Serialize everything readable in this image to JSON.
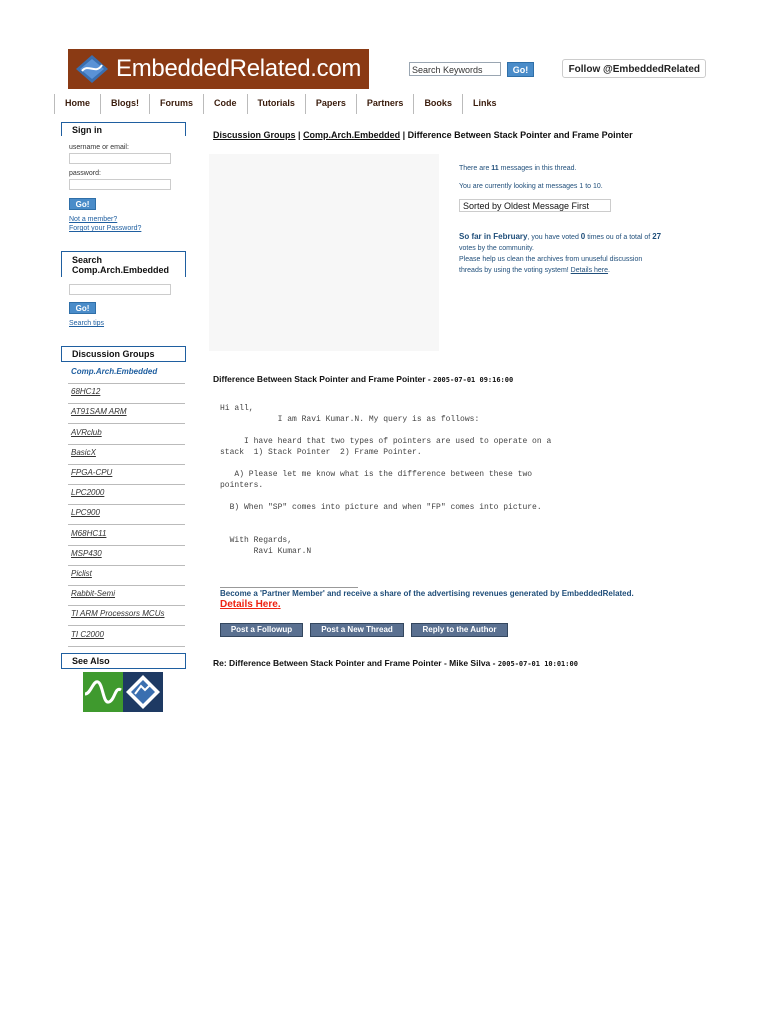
{
  "header": {
    "logo_text": "EmbeddedRelated.com",
    "search_placeholder": "Search Keywords",
    "search_button": "Go!",
    "follow_label": "Follow @EmbeddedRelated"
  },
  "nav": [
    "Home",
    "Blogs!",
    "Forums",
    "Code",
    "Tutorials",
    "Papers",
    "Partners",
    "Books",
    "Links"
  ],
  "signin": {
    "title": "Sign in",
    "username_label": "username or email:",
    "password_label": "password:",
    "go_button": "Go!",
    "not_member": "Not a member?",
    "forgot": "Forgot your Password?"
  },
  "search_group": {
    "title_line1": "Search",
    "title_line2": "Comp.Arch.Embedded",
    "go_button": "Go!",
    "tips": "Search tips"
  },
  "discussion_groups": {
    "title": "Discussion Groups",
    "items": [
      "Comp.Arch.Embedded",
      "68HC12",
      "AT91SAM ARM",
      "AVRclub",
      "BasicX",
      "FPGA-CPU",
      "LPC2000",
      "LPC900",
      "M68HC11",
      "MSP430",
      "Piclist",
      "Rabbit-Semi",
      "TI ARM Processors MCUs",
      "TI C2000"
    ]
  },
  "see_also": {
    "title": "See Also"
  },
  "breadcrumb": {
    "part1": "Discussion Groups",
    "sep": " | ",
    "part2": "Comp.Arch.Embedded",
    "part3": "Difference Between Stack Pointer and Frame Pointer"
  },
  "thread_info": {
    "count_pre": "There are ",
    "count": "11",
    "count_post": " messages in this thread.",
    "viewing": "You are currently looking at messages 1 to 10.",
    "sort": "Sorted by Oldest Message First",
    "vote_month": "So far in February",
    "vote_mid": ", you have voted ",
    "vote_count": "0",
    "vote_mid2": " times ou of a total of ",
    "vote_total": "27",
    "vote_line2": "votes by the community.",
    "vote_line3": "Please help us clean the archives from unuseful discussion",
    "vote_line4_pre": "threads by using the voting system! ",
    "vote_link": "Details here",
    "vote_end": "."
  },
  "message1": {
    "title": "Difference Between Stack Pointer and Frame Pointer - ",
    "date": "2005-07-01 09:16:00",
    "body": "Hi all,\n            I am Ravi Kumar.N. My query is as follows:\n\n     I have heard that two types of pointers are used to operate on a\nstack  1) Stack Pointer  2) Frame Pointer.\n\n   A) Please let me know what is the difference between these two\npointers.\n\n  B) When \"SP\" comes into picture and when \"FP\" comes into picture.\n\n\n  With Regards,\n       Ravi Kumar.N"
  },
  "partner": {
    "text": "Become a 'Partner Member' and receive a share of the advertising revenues generated by EmbeddedRelated.",
    "details": "Details Here",
    "details_end": "."
  },
  "actions": [
    "Post a Followup",
    "Post a New Thread",
    "Reply to the Author"
  ],
  "message2": {
    "title": "Re: Difference Between Stack Pointer and Frame Pointer - Mike Silva - ",
    "date": "2005-07-01 10:01:00"
  }
}
